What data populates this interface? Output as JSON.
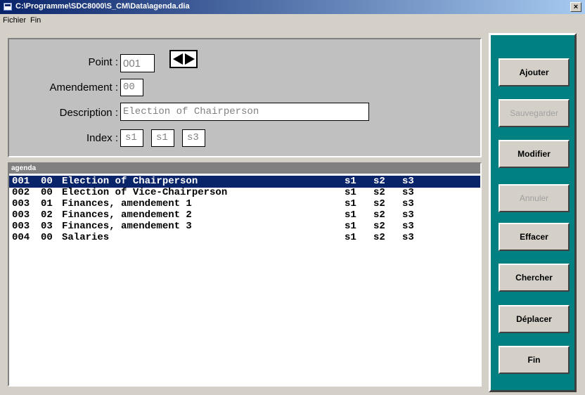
{
  "window": {
    "title": "C:\\Programme\\SDC8000\\S_CM\\Data\\agenda.dia",
    "close_label": "×"
  },
  "menu": {
    "items": [
      "Fichier",
      "Fin"
    ]
  },
  "form": {
    "point_label": "Point :",
    "point_value": "001",
    "amendement_label": "Amendement :",
    "amendement_value": "00",
    "description_label": "Description :",
    "description_value": "Election of Chairperson",
    "index_label": "Index :",
    "index_values": [
      "s1",
      "s1",
      "s3"
    ]
  },
  "list": {
    "header": "agenda",
    "rows": [
      {
        "point": "001",
        "amend": "00",
        "desc": "Election of Chairperson",
        "i1": "s1",
        "i2": "s2",
        "i3": "s3",
        "selected": true
      },
      {
        "point": "002",
        "amend": "00",
        "desc": "Election of Vice-Chairperson",
        "i1": "s1",
        "i2": "s2",
        "i3": "s3"
      },
      {
        "point": "003",
        "amend": "01",
        "desc": "Finances, amendement 1",
        "i1": "s1",
        "i2": "s2",
        "i3": "s3"
      },
      {
        "point": "003",
        "amend": "02",
        "desc": "Finances, amendement 2",
        "i1": "s1",
        "i2": "s2",
        "i3": "s3"
      },
      {
        "point": "003",
        "amend": "03",
        "desc": "Finances, amendement 3",
        "i1": "s1",
        "i2": "s2",
        "i3": "s3"
      },
      {
        "point": "004",
        "amend": "00",
        "desc": "Salaries",
        "i1": "s1",
        "i2": "s2",
        "i3": "s3"
      }
    ]
  },
  "buttons": {
    "ajouter": "Ajouter",
    "sauvegarder": "Sauvegarder",
    "modifier": "Modifier",
    "annuler": "Annuler",
    "effacer": "Effacer",
    "chercher": "Chercher",
    "deplacer": "Déplacer",
    "fin": "Fin"
  },
  "colors": {
    "sidebar": "#008080",
    "selection": "#0a246a",
    "title_gradient_start": "#0a246a"
  }
}
